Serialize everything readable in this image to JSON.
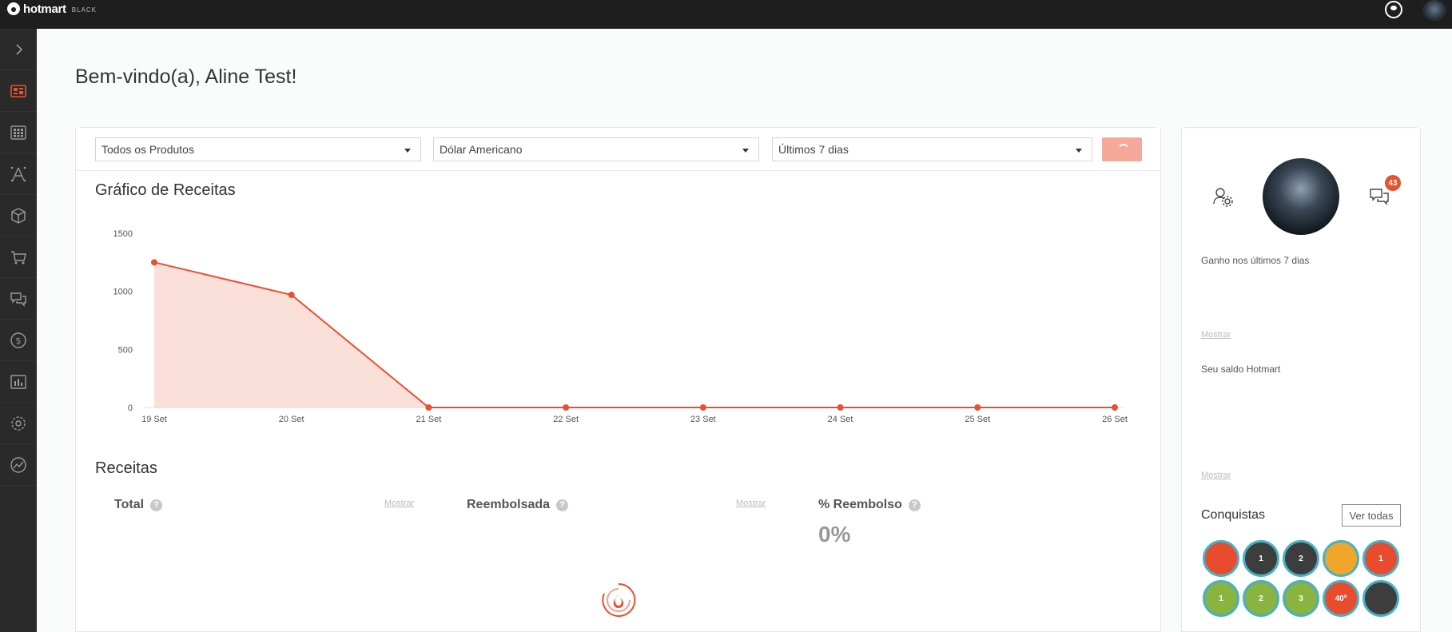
{
  "topbar": {
    "brand": "hotmart",
    "brand_sub": "BLACK"
  },
  "sidebar": {
    "items": [
      {
        "icon": "chevron-right-icon"
      },
      {
        "icon": "dashboard-icon",
        "active": true
      },
      {
        "icon": "apps-grid-icon"
      },
      {
        "icon": "affiliates-icon"
      },
      {
        "icon": "product-box-icon"
      },
      {
        "icon": "cart-icon"
      },
      {
        "icon": "chat-icon"
      },
      {
        "icon": "dollar-icon"
      },
      {
        "icon": "reports-icon"
      },
      {
        "icon": "settings-icon"
      },
      {
        "icon": "analytics-icon"
      }
    ]
  },
  "welcome": "Bem-vindo(a), Aline Test!",
  "filters": {
    "product": "Todos os Produtos",
    "currency": "Dólar Americano",
    "period": "Últimos 7 dias"
  },
  "chart_section_title": "Gráfico de Receitas",
  "chart_data": {
    "type": "area",
    "categories": [
      "19 Set",
      "20 Set",
      "21 Set",
      "22 Set",
      "23 Set",
      "24 Set",
      "25 Set",
      "26 Set"
    ],
    "values": [
      1250,
      970,
      0,
      0,
      0,
      0,
      0,
      0
    ],
    "y_ticks": [
      0,
      500,
      1000,
      1500
    ],
    "ylim": [
      0,
      1500
    ],
    "color": "#e9502e",
    "grid": false,
    "legend": "none"
  },
  "revenue": {
    "title": "Receitas",
    "total_label": "Total",
    "refunded_label": "Reembolsada",
    "refund_pct_label": "% Reembolso",
    "refund_pct_value": "0%",
    "show_label": "Mostrar"
  },
  "profile": {
    "notifications_count": "43",
    "earnings_label": "Ganho nos últimos 7 dias",
    "balance_label": "Seu saldo Hotmart",
    "show_label": "Mostrar"
  },
  "achievements": {
    "title": "Conquistas",
    "view_all": "Ver todas",
    "badges": [
      {
        "name": "badge-1",
        "label": "",
        "color": "red"
      },
      {
        "name": "badge-2",
        "label": "1",
        "color": "dark"
      },
      {
        "name": "badge-3",
        "label": "2",
        "color": "dark"
      },
      {
        "name": "badge-4",
        "label": "",
        "color": "gold"
      },
      {
        "name": "badge-5",
        "label": "1",
        "color": "red"
      },
      {
        "name": "badge-6",
        "label": "1",
        "color": "green"
      },
      {
        "name": "badge-7",
        "label": "2",
        "color": "green"
      },
      {
        "name": "badge-8",
        "label": "3",
        "color": "green"
      },
      {
        "name": "badge-9",
        "label": "40º",
        "color": "red"
      },
      {
        "name": "badge-10",
        "label": "",
        "color": "dark"
      }
    ]
  },
  "colors": {
    "accent": "#e9502e",
    "sidebar_bg": "#2a2a2a",
    "topbar_bg": "#1e1e1e"
  }
}
